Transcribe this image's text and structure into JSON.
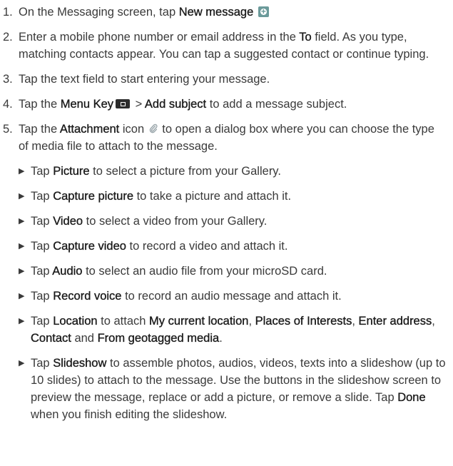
{
  "steps": [
    {
      "num": "1.",
      "t1": "On the Messaging screen, tap ",
      "b1": "New message"
    },
    {
      "num": "2.",
      "t1": "Enter a mobile phone number or email address in the ",
      "b1": "To",
      "t2": " field. As you type, matching contacts appear. You can tap a suggested contact or continue typing."
    },
    {
      "num": "3.",
      "t1": "Tap the text field to start entering your message."
    },
    {
      "num": "4.",
      "t1": "Tap the ",
      "b1": "Menu Key",
      "t2": " > ",
      "b2": "Add subject",
      "t3": " to add a message subject."
    },
    {
      "num": "5.",
      "t1": "Tap the ",
      "b1": "Attachment",
      "t2": " icon ",
      "t3": " to open a dialog box where you can choose the type of media file to attach to the message."
    }
  ],
  "bullets": [
    {
      "t1": "Tap ",
      "b1": "Picture",
      "t2": " to select a picture from your Gallery."
    },
    {
      "t1": "Tap ",
      "b1": "Capture picture",
      "t2": " to take a picture and attach it."
    },
    {
      "t1": "Tap ",
      "b1": "Video",
      "t2": " to select a video from your Gallery."
    },
    {
      "t1": "Tap ",
      "b1": "Capture video",
      "t2": " to record a video and attach it."
    },
    {
      "t1": "Tap ",
      "b1": "Audio",
      "t2": " to select an audio file from your microSD card."
    },
    {
      "t1": "Tap ",
      "b1": "Record voice",
      "t2": " to record an audio message and attach it."
    },
    {
      "t1": "Tap ",
      "b1": "Location",
      "t2": " to attach ",
      "b2": "My current location",
      "t3": ", ",
      "b3": "Places of Interests",
      "t4": ", ",
      "b4": "Enter address",
      "t5": ", ",
      "b5": "Contact",
      "t6": " and ",
      "b6": "From geotagged media",
      "t7": "."
    },
    {
      "t1": "Tap ",
      "b1": "Slideshow",
      "t2": " to assemble photos, audios, videos, texts into a slideshow (up to 10 slides) to attach to the message. Use the buttons in the slideshow screen to preview the message, replace or add a picture, or remove a slide. Tap ",
      "b2": "Done",
      "t3": " when you finish editing the slideshow."
    }
  ],
  "bullet_glyph": "▶",
  "icons": {
    "new_message": "new-message-plus-icon",
    "menu_key": "menu-key-icon",
    "attachment": "paperclip-icon"
  }
}
